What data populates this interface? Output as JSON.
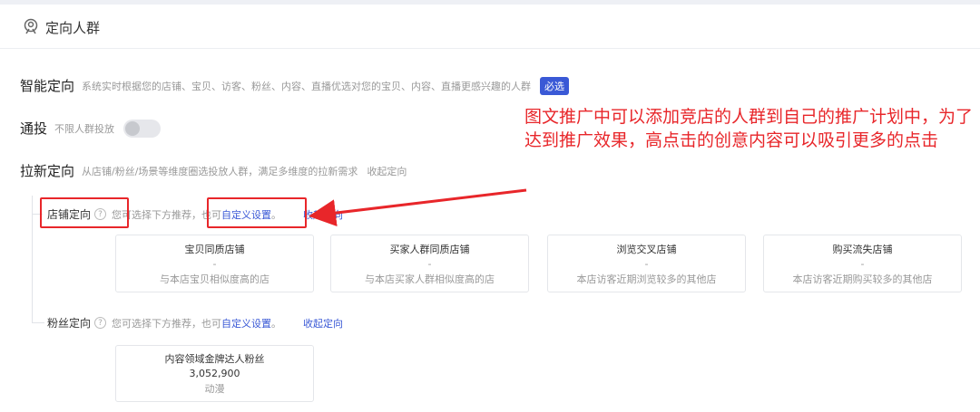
{
  "section": {
    "title": "定向人群",
    "icon": "targeting-people-icon"
  },
  "smart": {
    "label": "智能定向",
    "desc": "系统实时根据您的店铺、宝贝、访客、粉丝、内容、直播优选对您的宝贝、内容、直播更感兴趣的人群",
    "badge": "必选"
  },
  "broadcast": {
    "label": "通投",
    "desc": "不限人群投放",
    "enabled": false
  },
  "acquire": {
    "label": "拉新定向",
    "desc": "从店铺/粉丝/场景等维度圈选投放人群，满足多维度的拉新需求",
    "collapse": "收起定向"
  },
  "store_targeting": {
    "label": "店铺定向",
    "hint_prefix": "您可选择下方推荐，也可",
    "link": "自定义设置",
    "hint_suffix": "。",
    "collapse": "收起定向",
    "cards": [
      {
        "title": "宝贝同质店铺",
        "value": "-",
        "desc": "与本店宝贝相似度高的店"
      },
      {
        "title": "买家人群同质店铺",
        "value": "-",
        "desc": "与本店买家人群相似度高的店"
      },
      {
        "title": "浏览交叉店铺",
        "value": "-",
        "desc": "本店访客近期浏览较多的其他店"
      },
      {
        "title": "购买流失店铺",
        "value": "-",
        "desc": "本店访客近期购买较多的其他店"
      }
    ]
  },
  "fan_targeting": {
    "label": "粉丝定向",
    "hint_prefix": "您可选择下方推荐，也可",
    "link": "自定义设置",
    "hint_suffix": "。",
    "collapse": "收起定向",
    "cards": [
      {
        "title": "内容领域金牌达人粉丝",
        "value": "3,052,900",
        "desc": "动漫"
      }
    ]
  },
  "annotation": {
    "text": "图文推广中可以添加竞店的人群到自己的推广计划中，为了达到推广效果，高点击的创意内容可以吸引更多的点击",
    "color": "#e8262a"
  },
  "colors": {
    "accent": "#3a59d6",
    "highlight": "#e8262a"
  }
}
